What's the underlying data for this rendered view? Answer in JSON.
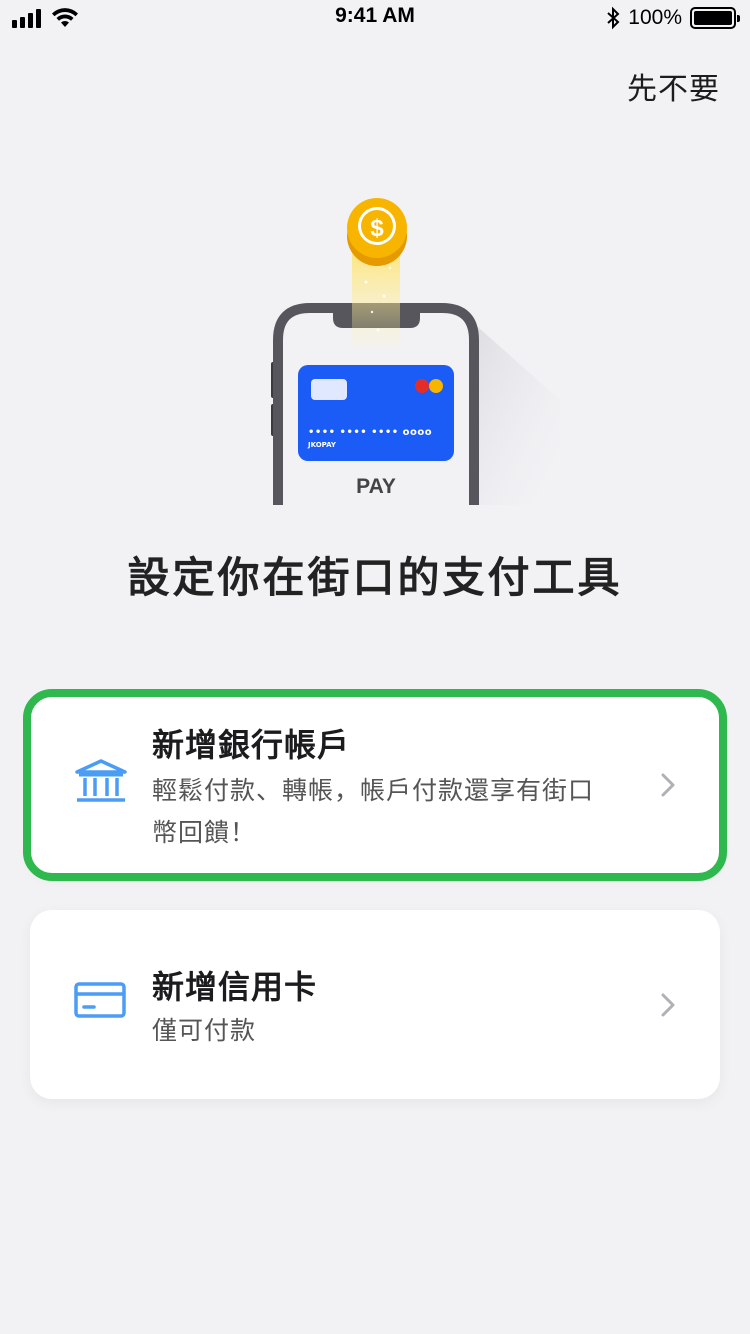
{
  "status_bar": {
    "time": "9:41 AM",
    "battery_text": "100%",
    "icons": [
      "signal-icon",
      "wifi-icon",
      "bluetooth-icon",
      "battery-icon"
    ]
  },
  "header": {
    "skip_label": "先不要"
  },
  "illustration": {
    "card_number": "•••• •••• •••• oooo",
    "card_brand": "JKOPAY",
    "phone_label": "PAY",
    "icons": [
      "coin-icon",
      "phone-icon",
      "credit-card-icon"
    ]
  },
  "main": {
    "title": "設定你在街口的支付工具"
  },
  "options": {
    "bank": {
      "label": "新增銀行帳戶",
      "desc_line1": "輕鬆付款、轉帳，帳戶付款還享有街口",
      "desc_line2": "幣回饋！",
      "icon": "bank-icon",
      "selected": true
    },
    "credit": {
      "label": "新增信用卡",
      "desc": "僅可付款",
      "icon": "credit-card-icon"
    }
  },
  "colors": {
    "background": "#f2f2f5",
    "accent_blue": "#4a9cf5",
    "card_blue": "#1a5cf5",
    "highlight_green": "#2fb84e",
    "coin_gold": "#f7b500"
  }
}
